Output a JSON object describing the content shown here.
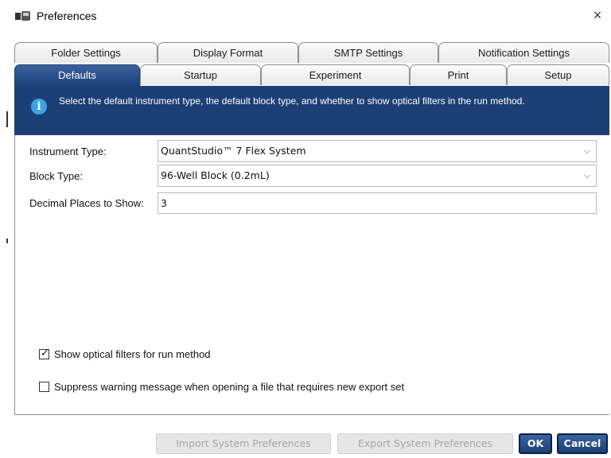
{
  "window": {
    "title": "Preferences",
    "close_glyph": "×"
  },
  "tabs_row1": [
    {
      "label": "Folder Settings"
    },
    {
      "label": "Display Format"
    },
    {
      "label": "SMTP Settings"
    },
    {
      "label": "Notification Settings"
    }
  ],
  "tabs_row2": [
    {
      "label": "Defaults",
      "active": true
    },
    {
      "label": "Startup"
    },
    {
      "label": "Experiment"
    },
    {
      "label": "Print"
    },
    {
      "label": "Setup"
    }
  ],
  "banner": {
    "icon": "info-icon",
    "glyph": "i",
    "text": "Select the default instrument type, the default block type, and whether to show optical filters in the run method."
  },
  "form": {
    "instrument_label": "Instrument Type:",
    "instrument_value": "QuantStudio™ 7 Flex System",
    "block_label": "Block Type:",
    "block_value": "96-Well Block (0.2mL)",
    "decimal_label": "Decimal Places to Show:",
    "decimal_value": "3",
    "chevron": "⌵"
  },
  "checkboxes": [
    {
      "label": "Show optical filters for run method",
      "checked": true
    },
    {
      "label": "Suppress warning message when opening a file that requires new export set",
      "checked": false
    }
  ],
  "buttons": {
    "import": "Import System Preferences",
    "export": "Export System Preferences",
    "ok": "OK",
    "cancel": "Cancel"
  },
  "colors": {
    "accent": "#1c3f76",
    "info": "#3fa4e6"
  }
}
